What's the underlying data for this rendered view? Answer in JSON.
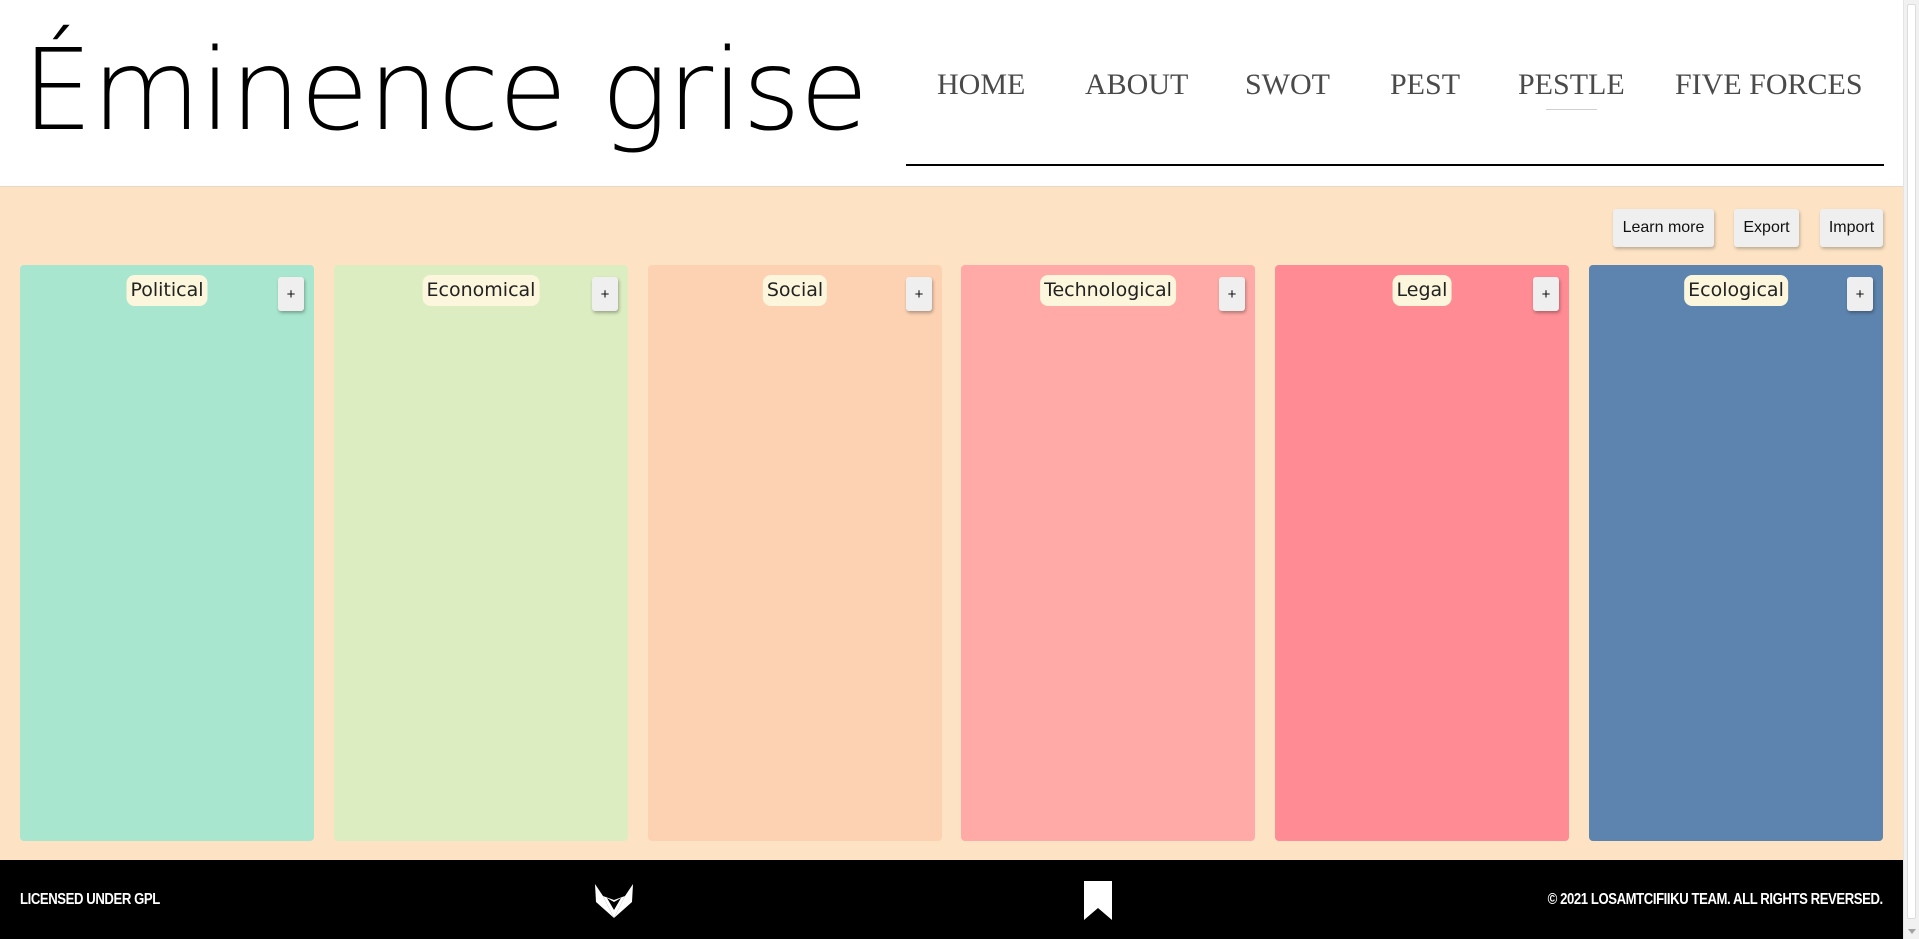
{
  "header": {
    "logo": "Éminence grise",
    "nav": [
      {
        "label": "HOME"
      },
      {
        "label": "ABOUT"
      },
      {
        "label": "SWOT"
      },
      {
        "label": "PEST"
      },
      {
        "label": "PESTLE",
        "active": true
      },
      {
        "label": "FIVE FORCES"
      }
    ]
  },
  "toolbar": {
    "learn_more": "Learn more",
    "export": "Export",
    "import": "Import"
  },
  "columns": [
    {
      "title": "Political",
      "color": "#a8e6cf",
      "add": "+"
    },
    {
      "title": "Economical",
      "color": "#dcedc1",
      "add": "+"
    },
    {
      "title": "Social",
      "color": "#fdd2b3",
      "add": "+"
    },
    {
      "title": "Technological",
      "color": "#ffaaa6",
      "add": "+"
    },
    {
      "title": "Legal",
      "color": "#ff8b94",
      "add": "+"
    },
    {
      "title": "Ecological",
      "color": "#5d84ae",
      "add": "+"
    }
  ],
  "footer": {
    "license": "LICENSED UNDER GPL",
    "copyright": "© 2021 LOSAMTCIFIIKU TEAM. ALL RIGHTS REVERSED.",
    "icons": [
      "gitlab-icon",
      "bookmark-icon"
    ]
  }
}
